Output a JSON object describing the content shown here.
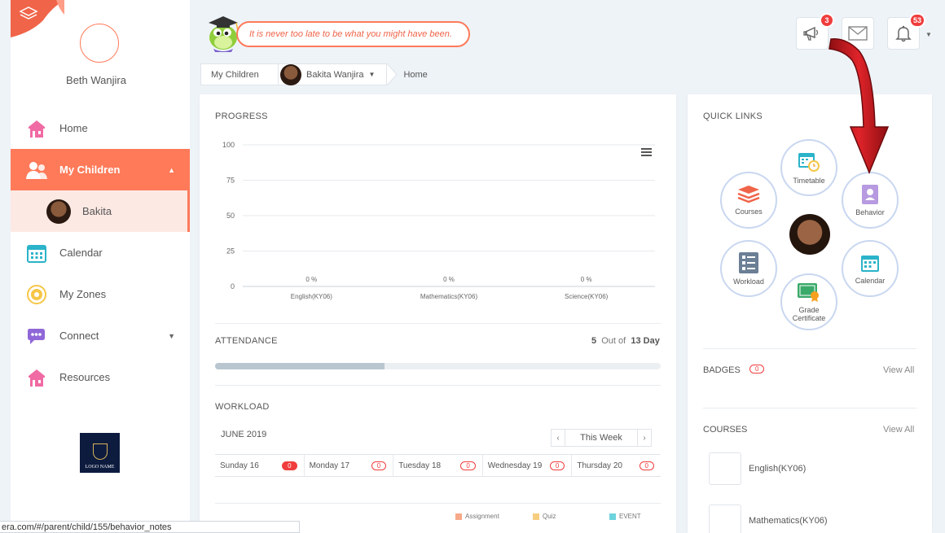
{
  "user": {
    "name": "Beth Wanjira"
  },
  "sidebar": {
    "items": [
      {
        "label": "Home",
        "icon": "home-icon"
      },
      {
        "label": "My Children",
        "icon": "children-icon"
      },
      {
        "label": "Bakita",
        "icon": "child-avatar"
      },
      {
        "label": "Calendar",
        "icon": "calendar-icon"
      },
      {
        "label": "My Zones",
        "icon": "zones-icon"
      },
      {
        "label": "Connect",
        "icon": "connect-icon"
      },
      {
        "label": "Resources",
        "icon": "resources-icon"
      }
    ],
    "logo_text": "LOGO NAME"
  },
  "header": {
    "quote": "It is never too late to be what you might have been.",
    "announcements_count": "3",
    "notifications_count": "53"
  },
  "breadcrumb": {
    "root": "My Children",
    "child": "Bakita Wanjira",
    "current": "Home"
  },
  "progress": {
    "title": "PROGRESS"
  },
  "chart_data": {
    "type": "bar",
    "categories": [
      "English(KY06)",
      "Mathematics(KY06)",
      "Science(KY06)"
    ],
    "values": [
      0,
      0,
      0
    ],
    "data_labels": [
      "0 %",
      "0 %",
      "0 %"
    ],
    "yticks": [
      "100",
      "75",
      "50",
      "25",
      "0"
    ],
    "ylim": [
      0,
      100
    ],
    "grid": true
  },
  "attendance": {
    "title": "ATTENDANCE",
    "present": "5",
    "out_of_label": "Out of",
    "total": "13 Day",
    "fraction": 0.38
  },
  "workload": {
    "title": "WORKLOAD",
    "month": "JUNE 2019",
    "week_label": "This Week",
    "prev": "‹",
    "next": "›",
    "days": [
      {
        "label": "Sunday 16",
        "count": "0",
        "filled": true
      },
      {
        "label": "Monday 17",
        "count": "0",
        "filled": false
      },
      {
        "label": "Tuesday 18",
        "count": "0",
        "filled": false
      },
      {
        "label": "Wednesday 19",
        "count": "0",
        "filled": false
      },
      {
        "label": "Thursday 20",
        "count": "0",
        "filled": false
      }
    ],
    "legend": [
      {
        "label": "Assignment",
        "color": "#f7a98b"
      },
      {
        "label": "Quiz",
        "color": "#f7cd7f"
      },
      {
        "label": "EVENT",
        "color": "#6dd3dd"
      }
    ]
  },
  "quick_links": {
    "title": "QUICK LINKS",
    "items": [
      {
        "label": "Timetable",
        "icon": "timetable-icon"
      },
      {
        "label": "Courses",
        "icon": "courses-icon"
      },
      {
        "label": "Behavior",
        "icon": "behavior-icon"
      },
      {
        "label": "Workload",
        "icon": "workload-icon"
      },
      {
        "label": "Calendar",
        "icon": "calendar-icon"
      },
      {
        "label": "Grade\nCertificate",
        "icon": "certificate-icon"
      }
    ]
  },
  "badges": {
    "title": "BADGES",
    "count": "0",
    "view_all": "View All"
  },
  "courses": {
    "title": "COURSES",
    "view_all": "View All",
    "items": [
      "English(KY06)",
      "Mathematics(KY06)"
    ]
  },
  "status_bar": {
    "url": "era.com/#/parent/child/155/behavior_notes"
  },
  "colors": {
    "accent": "#ff7a59",
    "badge": "#f03d3d",
    "arrow": "#d0161b"
  }
}
